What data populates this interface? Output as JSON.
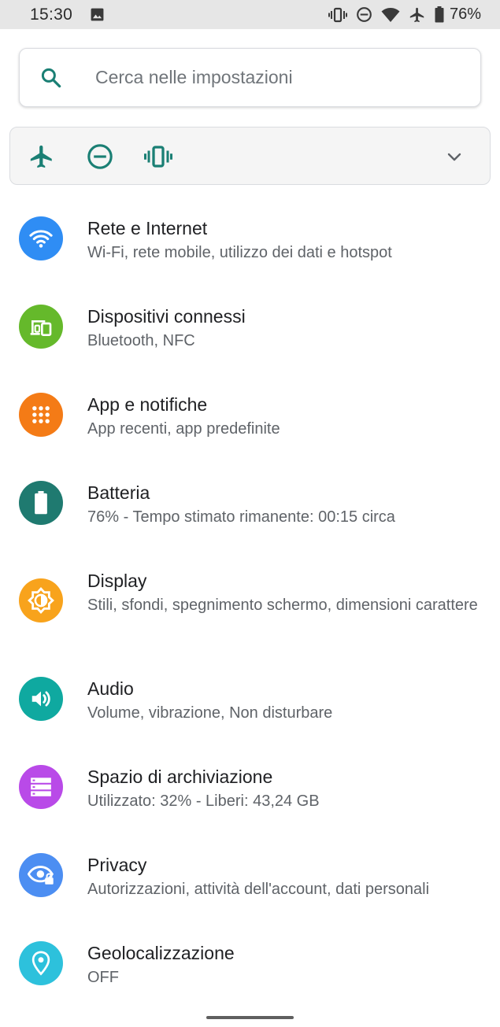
{
  "status_bar": {
    "time": "15:30",
    "battery_percent": "76%",
    "icons": [
      "image-icon",
      "vibrate-icon",
      "do-not-disturb-icon",
      "wifi-icon",
      "airplane-icon",
      "battery-icon"
    ]
  },
  "search": {
    "placeholder": "Cerca nelle impostazioni"
  },
  "quick_settings": {
    "buttons": [
      "airplane-mode",
      "do-not-disturb",
      "vibrate"
    ],
    "accent": "#1a7f74"
  },
  "settings": {
    "items": [
      {
        "title": "Rete e Internet",
        "subtitle": "Wi-Fi, rete mobile, utilizzo dei dati e hotspot",
        "icon": "wifi-icon",
        "color": "#2f8df4"
      },
      {
        "title": "Dispositivi connessi",
        "subtitle": "Bluetooth, NFC",
        "icon": "devices-icon",
        "color": "#65b92b"
      },
      {
        "title": "App e notifiche",
        "subtitle": "App recenti, app predefinite",
        "icon": "apps-grid-icon",
        "color": "#f47b16"
      },
      {
        "title": "Batteria",
        "subtitle": "76% - Tempo stimato rimanente: 00:15 circa",
        "icon": "battery-icon",
        "color": "#1f7a70"
      },
      {
        "title": "Display",
        "subtitle": "Stili, sfondi, spegnimento schermo, dimensioni carattere",
        "icon": "brightness-icon",
        "color": "#f8a31c"
      },
      {
        "title": "Audio",
        "subtitle": "Volume, vibrazione, Non disturbare",
        "icon": "volume-icon",
        "color": "#0fa9a0"
      },
      {
        "title": "Spazio di archiviazione",
        "subtitle": "Utilizzato: 32% - Liberi: 43,24 GB",
        "icon": "storage-icon",
        "color": "#b94ae8"
      },
      {
        "title": "Privacy",
        "subtitle": "Autorizzazioni, attività dell'account, dati personali",
        "icon": "privacy-eye-icon",
        "color": "#4c8ef2"
      },
      {
        "title": "Geolocalizzazione",
        "subtitle": "OFF",
        "icon": "location-icon",
        "color": "#2dc1dc"
      }
    ]
  }
}
